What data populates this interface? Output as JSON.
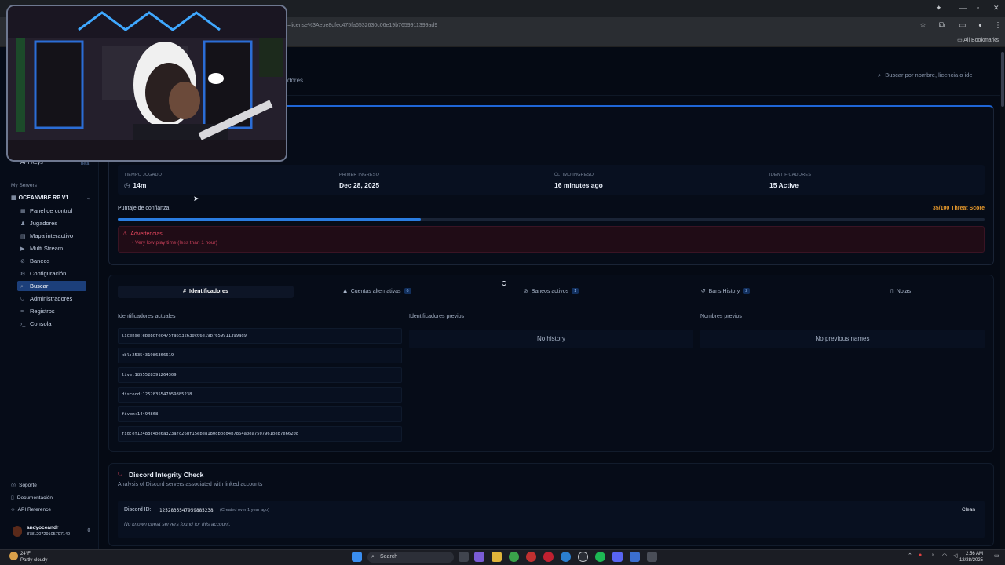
{
  "browser": {
    "url": "=license%3Aebe8dfec475fa6532630c06e19b7659911399ad9",
    "bookmarks_label": "All Bookmarks"
  },
  "header": {
    "nav_partial": "dores",
    "search_placeholder": "Buscar por nombre, licencia o ide"
  },
  "sidebar": {
    "api_keys_label": "API Keys",
    "api_keys_badge": "Beta",
    "section_label": "My Servers",
    "server_name": "OCEANVIBE RP V1",
    "items": [
      {
        "label": "Panel de control",
        "icon": "grid-icon"
      },
      {
        "label": "Jugadores",
        "icon": "users-icon"
      },
      {
        "label": "Mapa interactivo",
        "icon": "map-icon"
      },
      {
        "label": "Multi Stream",
        "icon": "video-icon"
      },
      {
        "label": "Baneos",
        "icon": "ban-icon"
      },
      {
        "label": "Configuración",
        "icon": "gear-icon"
      },
      {
        "label": "Buscar",
        "icon": "search-icon"
      },
      {
        "label": "Administradores",
        "icon": "shield-icon"
      },
      {
        "label": "Registros",
        "icon": "list-icon"
      },
      {
        "label": "Consola",
        "icon": "terminal-icon"
      }
    ],
    "footer": [
      {
        "label": "Soporte",
        "icon": "help-icon"
      },
      {
        "label": "Documentación",
        "icon": "book-icon"
      },
      {
        "label": "API Reference",
        "icon": "code-icon"
      }
    ],
    "user": {
      "name": "andyoceandr",
      "id": "878120729105797140"
    }
  },
  "stats": {
    "played_label": "TIEMPO JUGADO",
    "played_value": "14m",
    "first_label": "PRIMER INGRESO",
    "first_value": "Dec 28, 2025",
    "last_label": "ÚLTIMO INGRESO",
    "last_value": "16 minutes ago",
    "ids_label": "IDENTIFICADORES",
    "ids_value": "15 Active"
  },
  "trust": {
    "label": "Puntaje de confianza",
    "score_text": "35/100 Threat Score",
    "fill_percent": 35
  },
  "warnings": {
    "title": "Advertencias",
    "items": [
      "Very low play time (less than 1 hour)"
    ]
  },
  "tabs": [
    {
      "label": "Identificadores",
      "badge": ""
    },
    {
      "label": "Cuentas alternativas",
      "badge": "6"
    },
    {
      "label": "Baneos activos",
      "badge": "1"
    },
    {
      "label": "Bans History",
      "badge": "2"
    },
    {
      "label": "Notas",
      "badge": ""
    }
  ],
  "identifiers": {
    "current_title": "Identificadores actuales",
    "previous_title": "Identificadores previos",
    "names_title": "Nombres previos",
    "no_history": "No history",
    "no_names": "No previous names",
    "current": [
      "license:ebe8dfec475fa6532630c06e19b7659911399ad9",
      "xbl:2535431986366619",
      "live:1855528391264309",
      "discord:1252835547959885238",
      "fivem:14494868",
      "fid:ef12488c4be6a323afc26df15ebe8180dbbcd4b7864a0ea7507961be87e66208"
    ]
  },
  "discord": {
    "title": "Discord Integrity Check",
    "subtitle": "Analysis of Discord servers associated with linked accounts",
    "id_label": "Discord ID:",
    "id_value": "1252835547959885238",
    "created": "(Created over 1 year ago)",
    "status": "Clean",
    "message": "No known cheat servers found for this account."
  },
  "taskbar": {
    "weather_temp": "24°F",
    "weather_desc": "Partly cloudy",
    "search": "Search",
    "time": "2:56 AM",
    "date": "12/28/2025"
  },
  "colors": {
    "accent": "#2a7de1",
    "warning": "#e89a2c",
    "danger": "#e8475f",
    "background": "#050a14"
  }
}
